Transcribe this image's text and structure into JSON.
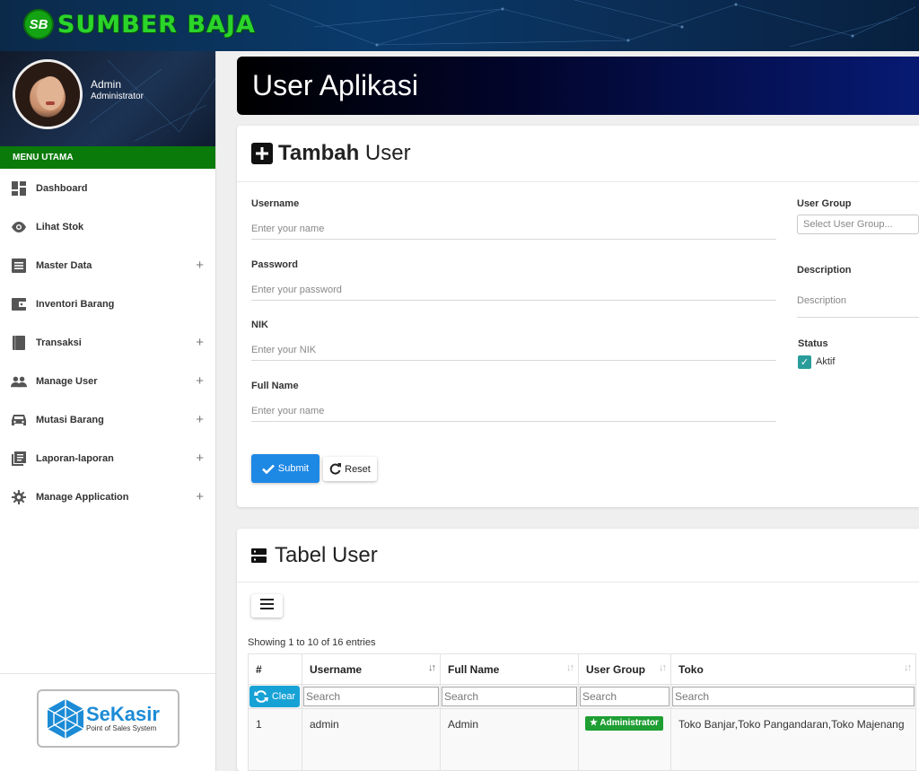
{
  "brand": {
    "logo_text": "SB",
    "name": "SUMBER BAJA"
  },
  "profile": {
    "name": "Admin",
    "role": "Administrator"
  },
  "menu": {
    "header": "MENU UTAMA",
    "items": [
      {
        "label": "Dashboard",
        "icon": "dashboard-icon",
        "expandable": false
      },
      {
        "label": "Lihat Stok",
        "icon": "eye-icon",
        "expandable": false
      },
      {
        "label": "Master Data",
        "icon": "list-icon",
        "expandable": true
      },
      {
        "label": "Inventori Barang",
        "icon": "wallet-icon",
        "expandable": false
      },
      {
        "label": "Transaksi",
        "icon": "book-icon",
        "expandable": true
      },
      {
        "label": "Manage User",
        "icon": "people-icon",
        "expandable": true
      },
      {
        "label": "Mutasi Barang",
        "icon": "car-icon",
        "expandable": true
      },
      {
        "label": "Laporan-laporan",
        "icon": "library-icon",
        "expandable": true
      },
      {
        "label": "Manage Application",
        "icon": "gear-icon",
        "expandable": true
      }
    ],
    "expand_symbol": "+"
  },
  "footer_logo": {
    "title": "SeKasir",
    "subtitle": "Point of Sales System"
  },
  "page": {
    "title": "User Aplikasi"
  },
  "form": {
    "title_bold": "Tambah",
    "title_rest": " User",
    "username": {
      "label": "Username",
      "placeholder": "Enter your name"
    },
    "password": {
      "label": "Password",
      "placeholder": "Enter your password"
    },
    "nik": {
      "label": "NIK",
      "placeholder": "Enter your NIK"
    },
    "full_name": {
      "label": "Full Name",
      "placeholder": "Enter your name"
    },
    "user_group": {
      "label": "User Group",
      "placeholder": "Select User Group..."
    },
    "description": {
      "label": "Description",
      "placeholder": "Description"
    },
    "status": {
      "label": "Status",
      "option_label": "Aktif",
      "checked": true
    },
    "submit_label": "Submit",
    "reset_label": "Reset",
    "accent_color": "#1e88e5"
  },
  "table": {
    "title": "Tabel User",
    "entries_info": "Showing 1 to 10 of 16 entries",
    "columns": [
      "#",
      "Username",
      "Full Name",
      "User Group",
      "Toko"
    ],
    "clear_label": "Clear",
    "search_placeholder": "Search",
    "rows": [
      {
        "no": "1",
        "username": "admin",
        "full_name": "Admin",
        "user_group": "Administrator",
        "toko": "Toko Banjar,Toko Pangandaran,Toko Majenang"
      }
    ]
  },
  "colors": {
    "brand_green": "#2bd42b",
    "menu_header": "#0a7a0a",
    "badge_green": "#1e9e33",
    "clear_blue": "#17a2d6"
  }
}
